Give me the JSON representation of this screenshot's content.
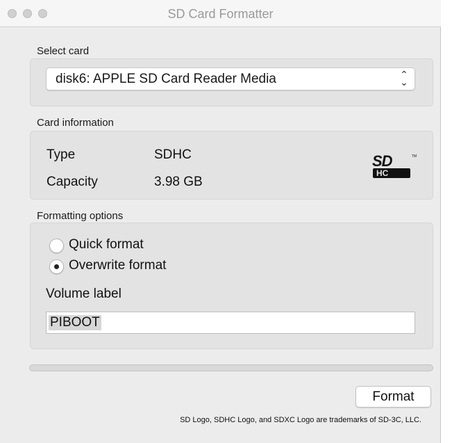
{
  "window": {
    "title": "SD Card Formatter"
  },
  "select_card": {
    "label": "Select card",
    "selected_value": "disk6: APPLE SD Card Reader Media"
  },
  "card_info": {
    "label": "Card information",
    "type_key": "Type",
    "type_value": "SDHC",
    "capacity_key": "Capacity",
    "capacity_value": "3.98 GB",
    "logo_icon": "sdhc-logo-icon"
  },
  "formatting": {
    "label": "Formatting options",
    "options": [
      {
        "label": "Quick format",
        "selected": false
      },
      {
        "label": "Overwrite format",
        "selected": true
      }
    ],
    "volume_label_title": "Volume label",
    "volume_label_value": "PIBOOT"
  },
  "progress": 0,
  "actions": {
    "format_label": "Format"
  },
  "footer": {
    "trademark": "SD Logo, SDHC Logo, and SDXC Logo are trademarks of SD-3C, LLC."
  }
}
